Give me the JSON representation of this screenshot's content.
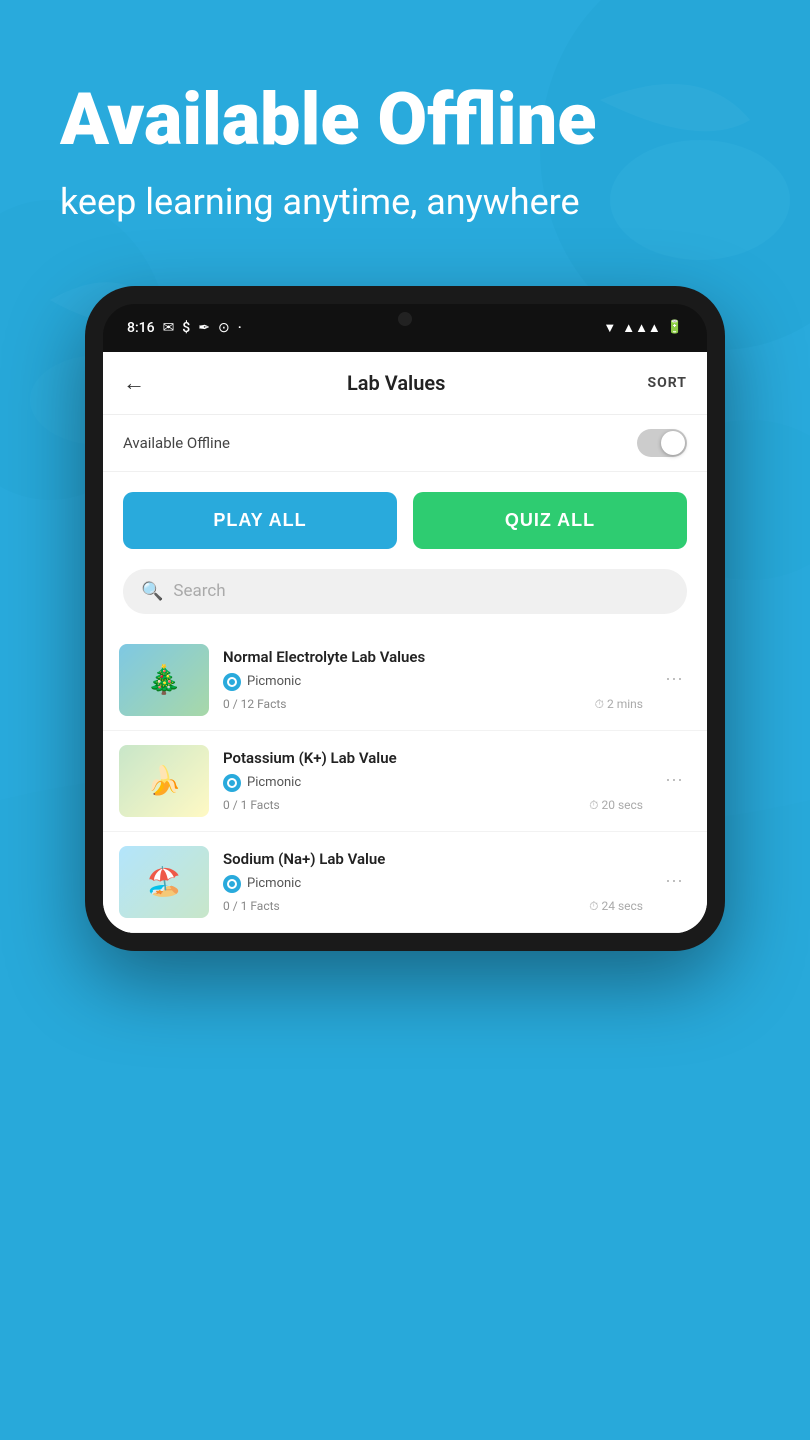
{
  "background": {
    "color": "#29aadc"
  },
  "header": {
    "title": "Available Offline",
    "subtitle": "keep learning anytime, anywhere"
  },
  "statusBar": {
    "time": "8:16",
    "icons": [
      "M",
      "$",
      "/",
      "⊙",
      "·"
    ]
  },
  "app": {
    "back_label": "←",
    "title": "Lab Values",
    "sort_label": "SORT",
    "offline_label": "Available Offline",
    "toggle_state": false,
    "play_all_label": "PLAY ALL",
    "quiz_all_label": "QUIZ ALL",
    "search_placeholder": "Search",
    "items": [
      {
        "title": "Normal Electrolyte Lab Values",
        "source": "Picmonic",
        "facts": "0 / 12 Facts",
        "time": "2 mins",
        "emoji": "🎄"
      },
      {
        "title": "Potassium (K+) Lab Value",
        "source": "Picmonic",
        "facts": "0 / 1 Facts",
        "time": "20 secs",
        "emoji": "🍌"
      },
      {
        "title": "Sodium (Na+) Lab Value",
        "source": "Picmonic",
        "facts": "0 / 1 Facts",
        "time": "24 secs",
        "emoji": "🏖️"
      }
    ]
  }
}
